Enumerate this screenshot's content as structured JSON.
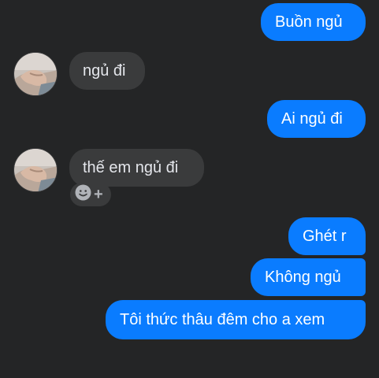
{
  "conversation": {
    "messages": [
      {
        "direction": "outgoing",
        "text": "Buồn ngủ"
      },
      {
        "direction": "incoming",
        "text": "ngủ đi"
      },
      {
        "direction": "outgoing",
        "text": "Ai ngủ đi"
      },
      {
        "direction": "incoming",
        "text": "thế em ngủ đi"
      },
      {
        "direction": "outgoing",
        "text": "Ghét r"
      },
      {
        "direction": "outgoing",
        "text": "Không ngủ"
      },
      {
        "direction": "outgoing",
        "text": "Tôi thức thâu đêm cho a xem"
      }
    ],
    "reaction_plus_glyph": "+"
  },
  "colors": {
    "background": "#242526",
    "outgoing_bubble": "#0a7cff",
    "incoming_bubble": "#3a3b3c",
    "incoming_text": "#e4e6eb",
    "outgoing_text": "#ffffff"
  },
  "icons": {
    "avatar": "contact-avatar-photo",
    "reaction": "smiley-face-icon",
    "add_reaction": "plus-icon"
  }
}
